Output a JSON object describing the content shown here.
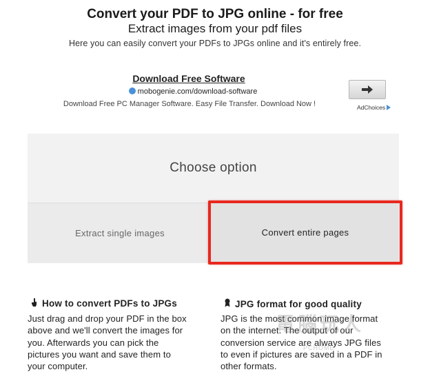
{
  "header": {
    "title": "Convert your PDF to JPG online - for free",
    "subtitle": "Extract images from your pdf files",
    "tagline": "Here you can easily convert your PDFs to JPGs online and it's entirely free."
  },
  "ad": {
    "title": "Download Free Software",
    "url": "mobogenie.com/download-software",
    "description": "Download Free PC Manager Software. Easy File Transfer. Download Now !",
    "arrow_icon": "right-arrow-icon",
    "adchoices": "AdChoices"
  },
  "options": {
    "heading": "Choose option",
    "left_label": "Extract single images",
    "right_label": "Convert entire pages",
    "highlight_color": "#e8281e"
  },
  "info": {
    "left_heading": "How to convert PDFs to JPGs",
    "left_icon": "hand-pointer-icon",
    "left_lines": [
      "Just drag and drop your PDF in the box",
      "above and we'll convert the images for",
      "you. Afterwards you can pick the",
      "pictures you want and save them to",
      "your computer."
    ],
    "right_heading": "JPG format for good quality",
    "right_icon": "award-ribbon-icon",
    "right_lines": [
      "JPG is the most common image format",
      "on the internet. The output of our",
      "conversion service are always JPG files",
      "to even if pictures are saved in a PDF in",
      "other formats."
    ]
  },
  "watermark": {
    "text": "電腦玩人",
    "sub": "PCHOME"
  }
}
